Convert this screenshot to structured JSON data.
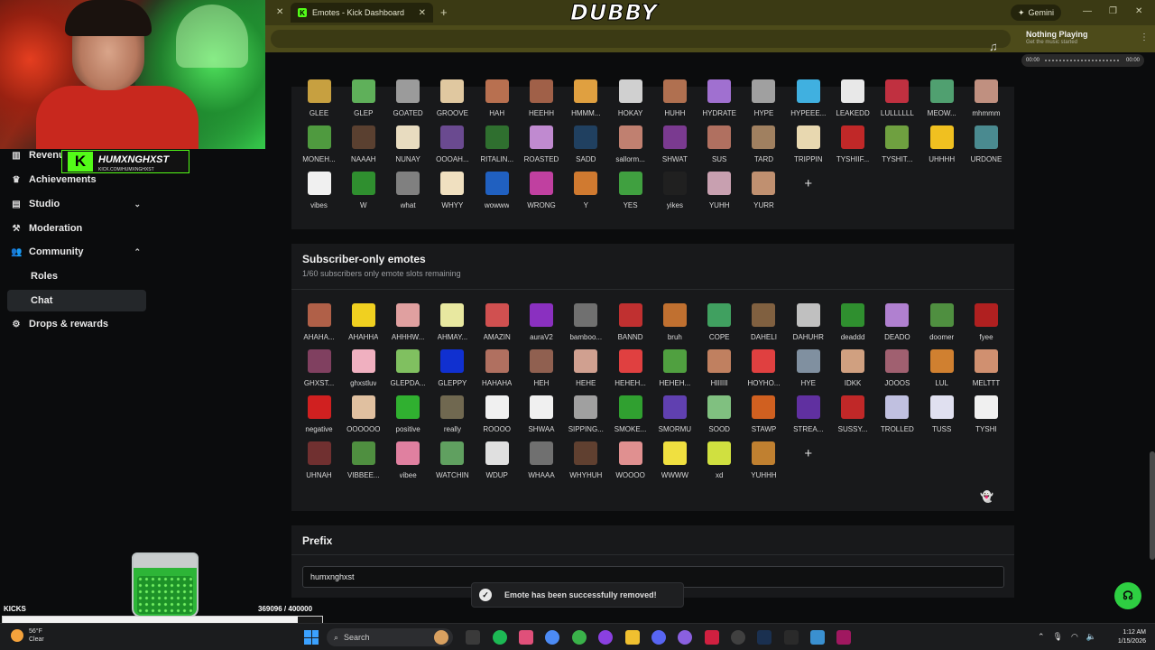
{
  "browser": {
    "tab_title": "Emotes - Kick Dashboard",
    "gemini_label": "Gemini",
    "overlay_title": "DUBBY"
  },
  "music": {
    "title": "Nothing Playing",
    "subtitle": "Get the music started",
    "time_start": "00:00",
    "time_end": "00:00"
  },
  "stream_overlay": {
    "name": "HUMXNGHXST",
    "url": "KICK.COM/HUMXNGHXST",
    "kicks_label": "KICKS",
    "kicks_count": "369096 / 400000",
    "kicks_progress": 0.9227
  },
  "sidebar": {
    "items": [
      {
        "label": "Revenue",
        "icon": "chart-icon"
      },
      {
        "label": "Achievements",
        "icon": "trophy-icon"
      },
      {
        "label": "Studio",
        "icon": "studio-icon"
      },
      {
        "label": "Moderation",
        "icon": "hammer-icon"
      },
      {
        "label": "Community",
        "icon": "people-icon"
      },
      {
        "label": "Drops & rewards",
        "icon": "drops-icon"
      }
    ],
    "sub_items": [
      {
        "label": "Roles"
      },
      {
        "label": "Chat"
      }
    ]
  },
  "top_emotes": {
    "items": [
      {
        "label": "GLEE",
        "color": "#c7a040"
      },
      {
        "label": "GLEP",
        "color": "#5fb05a"
      },
      {
        "label": "GOATED",
        "color": "#9b9b9b"
      },
      {
        "label": "GROOVE",
        "color": "#e0c8a0"
      },
      {
        "label": "HAH",
        "color": "#b87050"
      },
      {
        "label": "HEEHH",
        "color": "#a06048"
      },
      {
        "label": "HMMM...",
        "color": "#e0a040"
      },
      {
        "label": "HOKAY",
        "color": "#d0d0d0"
      },
      {
        "label": "HUHH",
        "color": "#b07050"
      },
      {
        "label": "HYDRATE",
        "color": "#a070d0"
      },
      {
        "label": "HYPE",
        "color": "#a0a0a0"
      },
      {
        "label": "HYPEEE...",
        "color": "#40b0e0"
      },
      {
        "label": "LEAKEDD",
        "color": "#e8e8e8"
      },
      {
        "label": "LULLLLLL",
        "color": "#c03040"
      },
      {
        "label": "MEOW...",
        "color": "#50a070"
      },
      {
        "label": "mhmmm",
        "color": "#c09080"
      },
      {
        "label": "MONEH...",
        "color": "#4f9a3f"
      },
      {
        "label": "NAAAH",
        "color": "#5a4030"
      },
      {
        "label": "NUNAY",
        "color": "#e8dcc0"
      },
      {
        "label": "OOOAH...",
        "color": "#6a4a90"
      },
      {
        "label": "RITALIN...",
        "color": "#2f6f2f"
      },
      {
        "label": "ROASTED",
        "color": "#c08ad0"
      },
      {
        "label": "SADD",
        "color": "#204060"
      },
      {
        "label": "sallorm...",
        "color": "#c08070"
      },
      {
        "label": "SHWAT",
        "color": "#7a3a90"
      },
      {
        "label": "SUS",
        "color": "#b07060"
      },
      {
        "label": "TARD",
        "color": "#a08060"
      },
      {
        "label": "TRIPPIN",
        "color": "#e8d8b0"
      },
      {
        "label": "TYSHIIF...",
        "color": "#c02828"
      },
      {
        "label": "TYSHIT...",
        "color": "#6fa040"
      },
      {
        "label": "UHHHH",
        "color": "#f0c020"
      },
      {
        "label": "URDONE",
        "color": "#4a8a90"
      },
      {
        "label": "vibes",
        "color": "#f0f0f0"
      },
      {
        "label": "W",
        "color": "#2f8f2f"
      },
      {
        "label": "what",
        "color": "#808080"
      },
      {
        "label": "WHYY",
        "color": "#f0e0c0"
      },
      {
        "label": "wowww",
        "color": "#2060c0"
      },
      {
        "label": "WRONG",
        "color": "#c040a0"
      },
      {
        "label": "Y",
        "color": "#d07a30"
      },
      {
        "label": "YES",
        "color": "#40a040"
      },
      {
        "label": "yikes",
        "color": "#202020"
      },
      {
        "label": "YUHH",
        "color": "#c8a0b0"
      },
      {
        "label": "YURR",
        "color": "#c09070"
      }
    ],
    "add_label": "+"
  },
  "subscriber_emotes": {
    "title": "Subscriber-only emotes",
    "description": "1/60 subscribers only emote slots remaining",
    "items": [
      {
        "label": "AHAHA...",
        "color": "#b06048"
      },
      {
        "label": "AHAHHA",
        "color": "#f0d020"
      },
      {
        "label": "AHHHW...",
        "color": "#e0a0a0"
      },
      {
        "label": "AHMAY...",
        "color": "#e8e8a0"
      },
      {
        "label": "AMAZIN",
        "color": "#d05050"
      },
      {
        "label": "auraV2",
        "color": "#8a30c0"
      },
      {
        "label": "bamboo...",
        "color": "#707070"
      },
      {
        "label": "BANND",
        "color": "#c03030"
      },
      {
        "label": "bruh",
        "color": "#c07030"
      },
      {
        "label": "COPE",
        "color": "#40a060"
      },
      {
        "label": "DAHELI",
        "color": "#806040"
      },
      {
        "label": "DAHUHR",
        "color": "#c0c0c0"
      },
      {
        "label": "deaddd",
        "color": "#2f8f2f"
      },
      {
        "label": "DEADO",
        "color": "#b080d0"
      },
      {
        "label": "doomer",
        "color": "#4f8f40"
      },
      {
        "label": "fyee",
        "color": "#b02020"
      },
      {
        "label": "GHXST...",
        "color": "#804060"
      },
      {
        "label": "ghxstluv",
        "color": "#f0b0c0"
      },
      {
        "label": "GLEPDA...",
        "color": "#80c060"
      },
      {
        "label": "GLEPPY",
        "color": "#1030d0"
      },
      {
        "label": "HAHAHA",
        "color": "#b07060"
      },
      {
        "label": "HEH",
        "color": "#906050"
      },
      {
        "label": "HEHE",
        "color": "#d0a090"
      },
      {
        "label": "HEHEH...",
        "color": "#e04040"
      },
      {
        "label": "HEHEH...",
        "color": "#50a040"
      },
      {
        "label": "HIIIIII",
        "color": "#c08060"
      },
      {
        "label": "HOYHO...",
        "color": "#e04040"
      },
      {
        "label": "HYE",
        "color": "#8090a0"
      },
      {
        "label": "IDKK",
        "color": "#d0a080"
      },
      {
        "label": "JOOOS",
        "color": "#a06070"
      },
      {
        "label": "LUL",
        "color": "#d08030"
      },
      {
        "label": "MELTTT",
        "color": "#d09070"
      },
      {
        "label": "negative",
        "color": "#d02020"
      },
      {
        "label": "OOOOOO",
        "color": "#e0c0a0"
      },
      {
        "label": "positive",
        "color": "#30b030"
      },
      {
        "label": "really",
        "color": "#706850"
      },
      {
        "label": "ROOOO",
        "color": "#f0f0f0"
      },
      {
        "label": "SHWAA",
        "color": "#f0f0f0"
      },
      {
        "label": "SIPPING...",
        "color": "#a0a0a0"
      },
      {
        "label": "SMOKE...",
        "color": "#30a030"
      },
      {
        "label": "SMORMU",
        "color": "#6040b0"
      },
      {
        "label": "SOOD",
        "color": "#80c080"
      },
      {
        "label": "STAWP",
        "color": "#d06020"
      },
      {
        "label": "STREA...",
        "color": "#6030a0"
      },
      {
        "label": "SUSSY...",
        "color": "#c02828"
      },
      {
        "label": "TROLLED",
        "color": "#c0c0e0"
      },
      {
        "label": "TUSS",
        "color": "#e0e0f0"
      },
      {
        "label": "TYSHI",
        "color": "#f0f0f0"
      },
      {
        "label": "UHNAH",
        "color": "#703030"
      },
      {
        "label": "VIBBEE...",
        "color": "#4f8f40"
      },
      {
        "label": "vibee",
        "color": "#e080a0"
      },
      {
        "label": "WATCHIN",
        "color": "#60a060"
      },
      {
        "label": "WDUP",
        "color": "#e0e0e0"
      },
      {
        "label": "WHAAA",
        "color": "#707070"
      },
      {
        "label": "WHYHUH",
        "color": "#604030"
      },
      {
        "label": "WOOOO",
        "color": "#e09090"
      },
      {
        "label": "WWWW",
        "color": "#f0e040"
      },
      {
        "label": "xd",
        "color": "#d0e040"
      },
      {
        "label": "YUHHH",
        "color": "#c08030"
      }
    ],
    "add_label": "+"
  },
  "prefix": {
    "title": "Prefix",
    "value": "humxnghxst"
  },
  "toast": {
    "message": "Emote has been successfully removed!"
  },
  "taskbar": {
    "temperature": "56°F",
    "weather": "Clear",
    "search_placeholder": "Search",
    "time": "1:12 AM",
    "date": "1/15/2026"
  },
  "colors": {
    "accent": "#53fc18",
    "panel": "#18191b",
    "background": "#0b0c0d"
  }
}
